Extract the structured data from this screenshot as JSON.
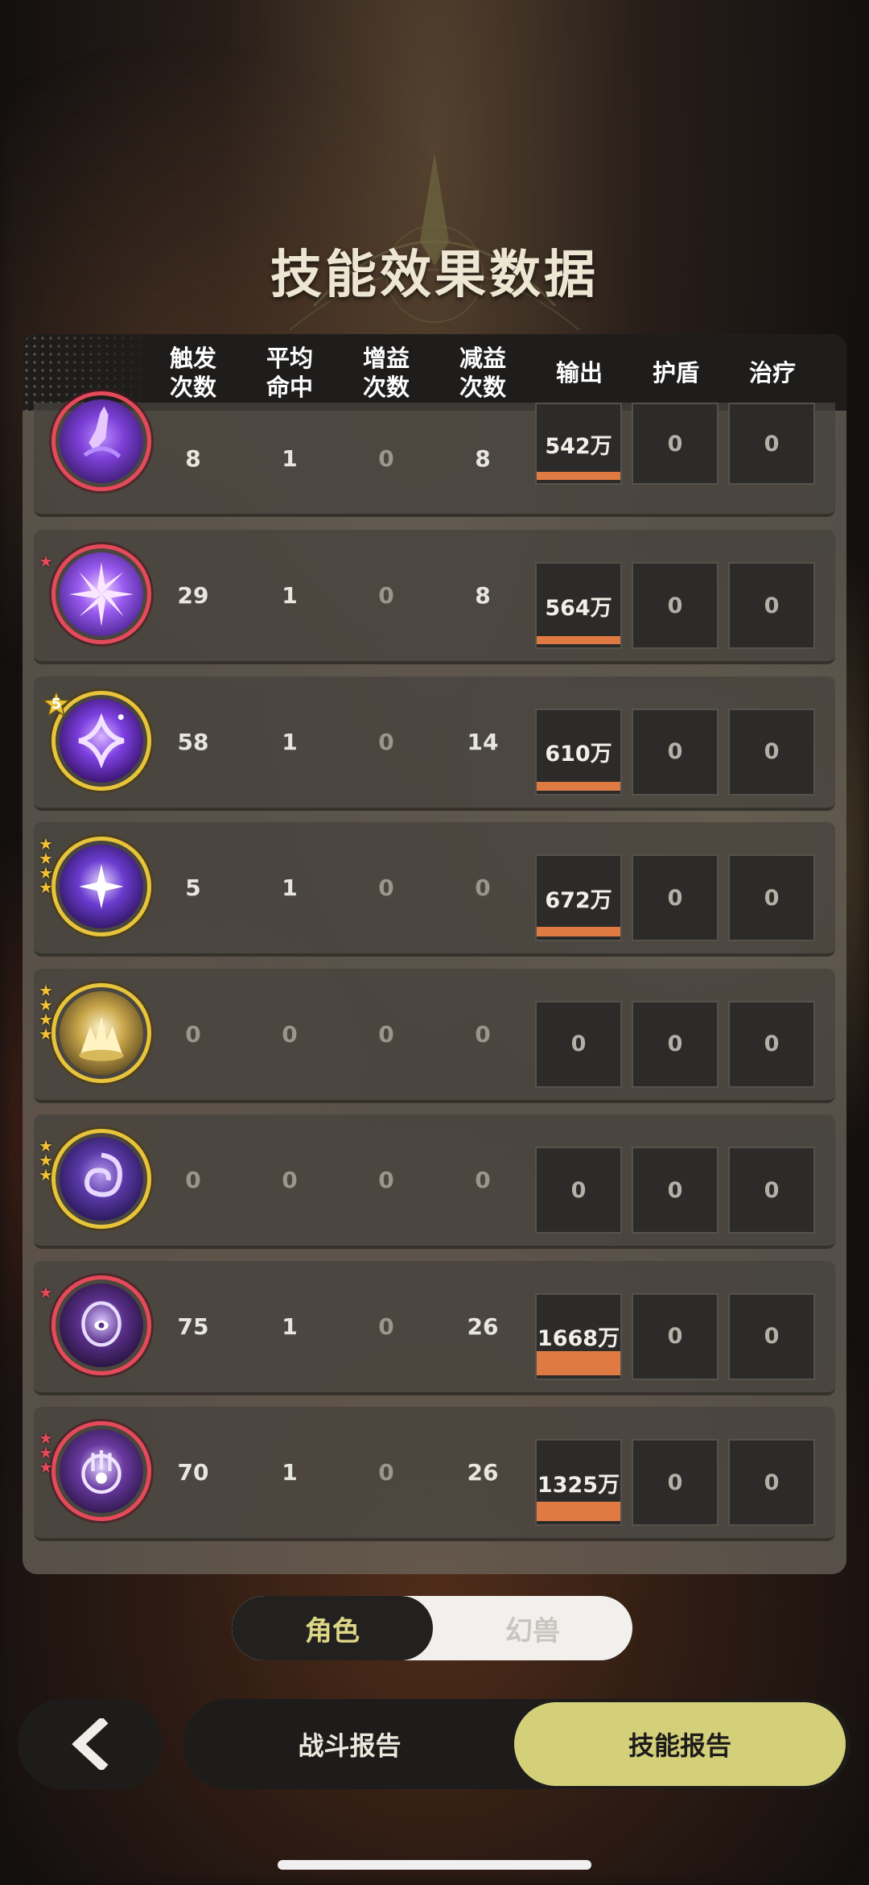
{
  "title": "技能效果数据",
  "header": {
    "columns": [
      "触发\n次数",
      "平均\n命中",
      "增益\n次数",
      "减益\n次数",
      "输出",
      "护盾",
      "治疗"
    ]
  },
  "rows": [
    {
      "icon": "purple-fist-skill-icon",
      "ring": "red",
      "stars": "",
      "trigger": "8",
      "avg_hit": "1",
      "buff": "0",
      "debuff": "8",
      "output": "542万",
      "output_fill_pct": 32,
      "shield": "0",
      "heal": "0"
    },
    {
      "icon": "purple-burst-skill-icon",
      "ring": "red",
      "stars": "red1",
      "trigger": "29",
      "avg_hit": "1",
      "buff": "0",
      "debuff": "8",
      "output": "564万",
      "output_fill_pct": 34,
      "shield": "0",
      "heal": "0"
    },
    {
      "icon": "purple-diamond-skill-icon",
      "ring": "gold",
      "stars": "badge5",
      "badge": "5",
      "trigger": "58",
      "avg_hit": "1",
      "buff": "0",
      "debuff": "14",
      "output": "610万",
      "output_fill_pct": 37,
      "shield": "0",
      "heal": "0"
    },
    {
      "icon": "purple-vortex-skill-icon",
      "ring": "gold",
      "stars": "gold4",
      "trigger": "5",
      "avg_hit": "1",
      "buff": "0",
      "debuff": "0",
      "output": "672万",
      "output_fill_pct": 40,
      "shield": "0",
      "heal": "0"
    },
    {
      "icon": "golden-flame-skill-icon",
      "ring": "gold",
      "stars": "gold4",
      "trigger": "0",
      "avg_hit": "0",
      "buff": "0",
      "debuff": "0",
      "output": "0",
      "output_fill_pct": 0,
      "shield": "0",
      "heal": "0"
    },
    {
      "icon": "purple-swirl-skill-icon",
      "ring": "gold",
      "stars": "gold3",
      "trigger": "0",
      "avg_hit": "0",
      "buff": "0",
      "debuff": "0",
      "output": "0",
      "output_fill_pct": 0,
      "shield": "0",
      "heal": "0"
    },
    {
      "icon": "purple-eye-figure-skill-icon",
      "ring": "red",
      "stars": "red1",
      "trigger": "75",
      "avg_hit": "1",
      "buff": "0",
      "debuff": "26",
      "output": "1668万",
      "output_fill_pct": 100,
      "shield": "0",
      "heal": "0"
    },
    {
      "icon": "purple-rune-skill-icon",
      "ring": "red",
      "stars": "red3",
      "trigger": "70",
      "avg_hit": "1",
      "buff": "0",
      "debuff": "26",
      "output": "1325万",
      "output_fill_pct": 79,
      "shield": "0",
      "heal": "0"
    }
  ],
  "toggle": {
    "left": "角色",
    "right": "幻兽",
    "selected": "left"
  },
  "bottom": {
    "back_icon": "chevron-left-icon",
    "tab_battle": "战斗报告",
    "tab_skill": "技能报告",
    "active_tab": "skill"
  },
  "colors": {
    "accent": "#d4d07a",
    "bar": "#e07a43",
    "ring_red": "#e64a5a",
    "ring_gold": "#e8c43a"
  }
}
